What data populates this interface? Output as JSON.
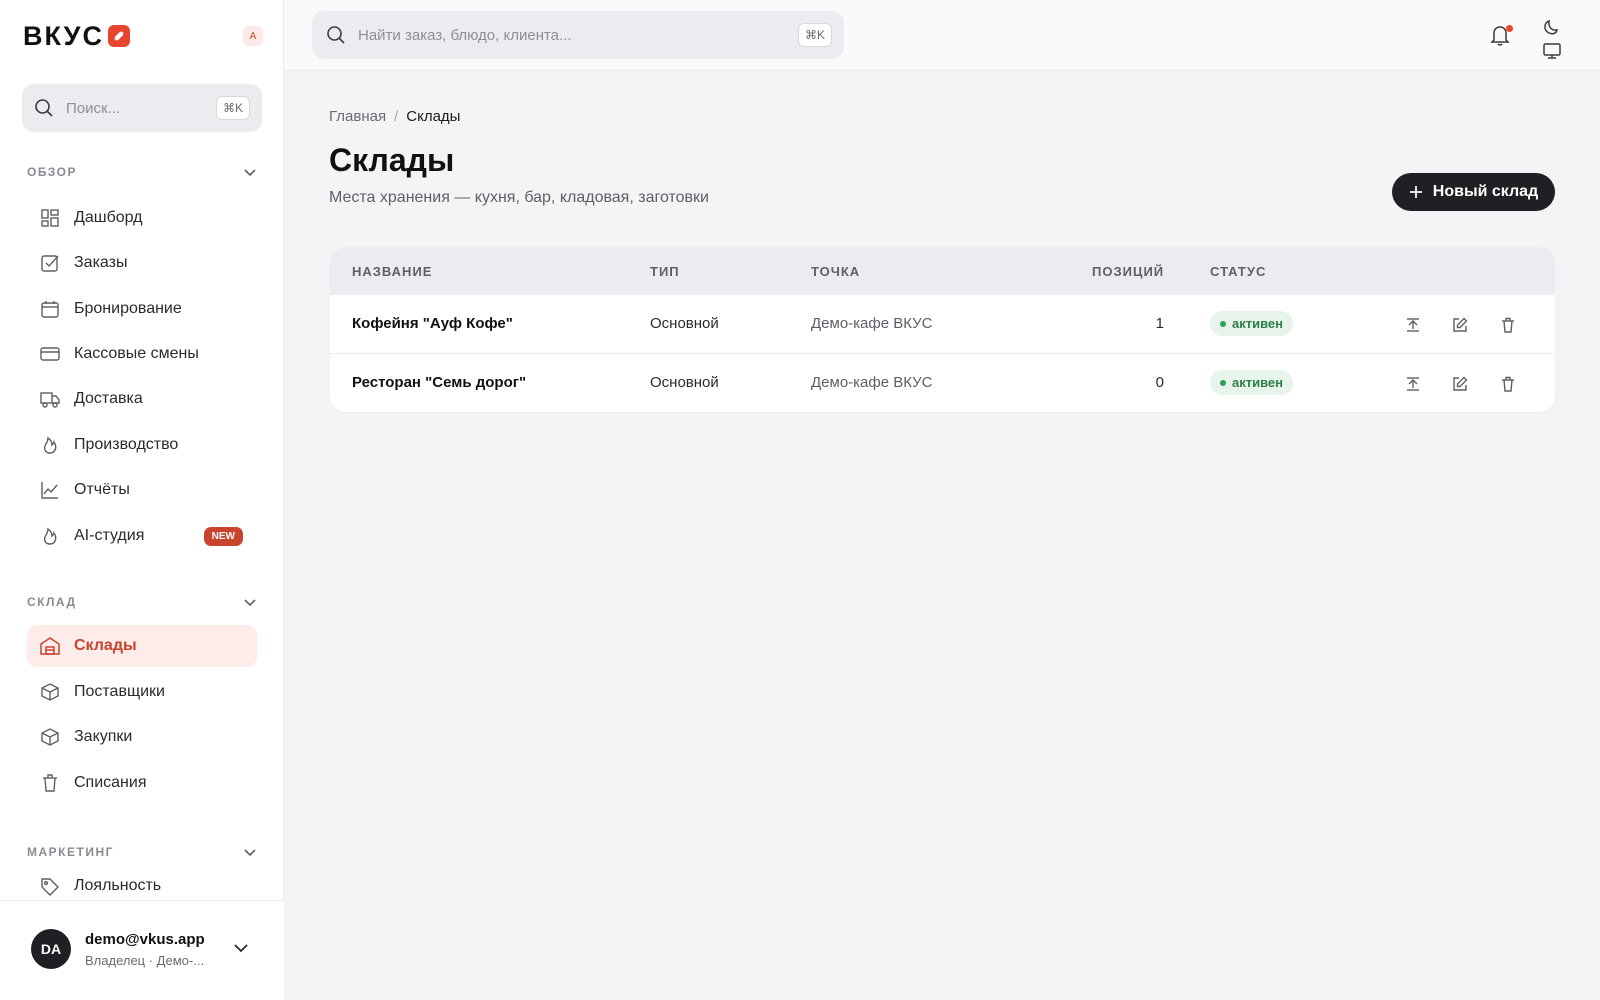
{
  "brand": {
    "name": "ВКУС",
    "workspace_badge": "A"
  },
  "sidebar": {
    "search": {
      "placeholder": "Поиск...",
      "shortcut": "⌘K"
    },
    "sections": {
      "overview": {
        "title": "ОБЗОР",
        "items": [
          {
            "label": "Дашборд",
            "icon": "dashboard-icon"
          },
          {
            "label": "Заказы",
            "icon": "checkbox-icon"
          },
          {
            "label": "Бронирование",
            "icon": "calendar-icon"
          },
          {
            "label": "Кассовые смены",
            "icon": "card-icon"
          },
          {
            "label": "Доставка",
            "icon": "truck-icon"
          },
          {
            "label": "Производство",
            "icon": "flame-icon"
          },
          {
            "label": "Отчёты",
            "icon": "chart-icon"
          },
          {
            "label": "AI-студия",
            "icon": "flame-icon",
            "badge": "NEW"
          }
        ]
      },
      "warehouse": {
        "title": "СКЛАД",
        "items": [
          {
            "label": "Склады",
            "icon": "warehouse-icon",
            "active": true
          },
          {
            "label": "Поставщики",
            "icon": "box-icon"
          },
          {
            "label": "Закупки",
            "icon": "box-icon"
          },
          {
            "label": "Списания",
            "icon": "trash-icon"
          }
        ]
      },
      "marketing": {
        "title": "МАРКЕТИНГ",
        "items": [
          {
            "label": "Лояльность",
            "icon": "tag-icon"
          }
        ]
      }
    },
    "user": {
      "initials": "DA",
      "email": "demo@vkus.app",
      "role": "Владелец · Демо-..."
    }
  },
  "topbar": {
    "search": {
      "placeholder": "Найти заказ, блюдо, клиента...",
      "shortcut": "⌘K"
    }
  },
  "main": {
    "breadcrumb": {
      "home": "Главная",
      "separator": "/",
      "current": "Склады"
    },
    "title": "Склады",
    "subtitle": "Места хранения — кухня, бар, кладовая, заготовки",
    "new_button": "Новый склад",
    "table": {
      "headers": {
        "name": "НАЗВАНИЕ",
        "type": "ТИП",
        "point": "ТОЧКА",
        "positions": "ПОЗИЦИЙ",
        "status": "СТАТУС"
      },
      "rows": [
        {
          "name": "Кофейня \"Ауф Кофе\"",
          "type": "Основной",
          "point": "Демо-кафе ВКУС",
          "positions": "1",
          "status": "активен"
        },
        {
          "name": "Ресторан \"Семь дорог\"",
          "type": "Основной",
          "point": "Демо-кафе ВКУС",
          "positions": "0",
          "status": "активен"
        }
      ]
    }
  },
  "colors": {
    "accent": "#c9442e",
    "brand": "#e8452c",
    "active_bg": "#fdecea",
    "status_bg": "#e6f4ea",
    "status_text": "#2e7d4a"
  }
}
